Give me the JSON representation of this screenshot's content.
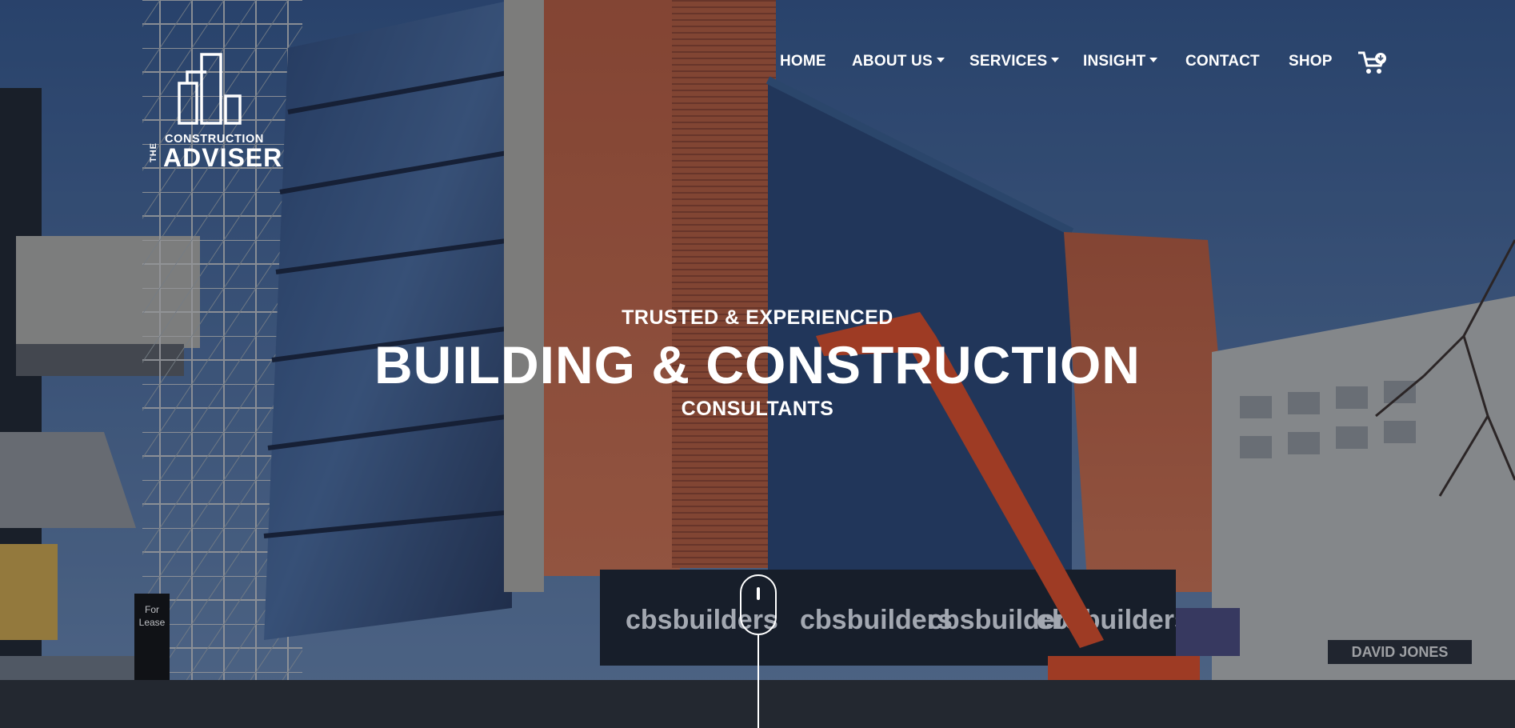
{
  "brand": {
    "the": "THE",
    "construction": "CONSTRUCTION",
    "adviser": "ADVISER",
    "logo_icon": "buildings-icon"
  },
  "nav": {
    "items": [
      {
        "label": "HOME",
        "dropdown": false
      },
      {
        "label": "ABOUT US",
        "dropdown": true
      },
      {
        "label": "SERVICES",
        "dropdown": true
      },
      {
        "label": "INSIGHT",
        "dropdown": true
      },
      {
        "label": "CONTACT",
        "dropdown": false
      },
      {
        "label": "SHOP",
        "dropdown": false
      }
    ],
    "cart_icon": "cart-icon"
  },
  "hero": {
    "kicker": "TRUSTED & EXPERIENCED",
    "headline": "BUILDING & CONSTRUCTION",
    "subline": "CONSULTANTS",
    "scroll_icon": "mouse-scroll-icon",
    "background": {
      "sign_for_lease": "For Lease",
      "banner_text": "cbsbuilders",
      "store_sign": "DAVID JONES"
    }
  },
  "colors": {
    "text": "#ffffff",
    "sky": "#3f5d8a",
    "cladding": "#c8694a",
    "crane": "#e0532a"
  }
}
